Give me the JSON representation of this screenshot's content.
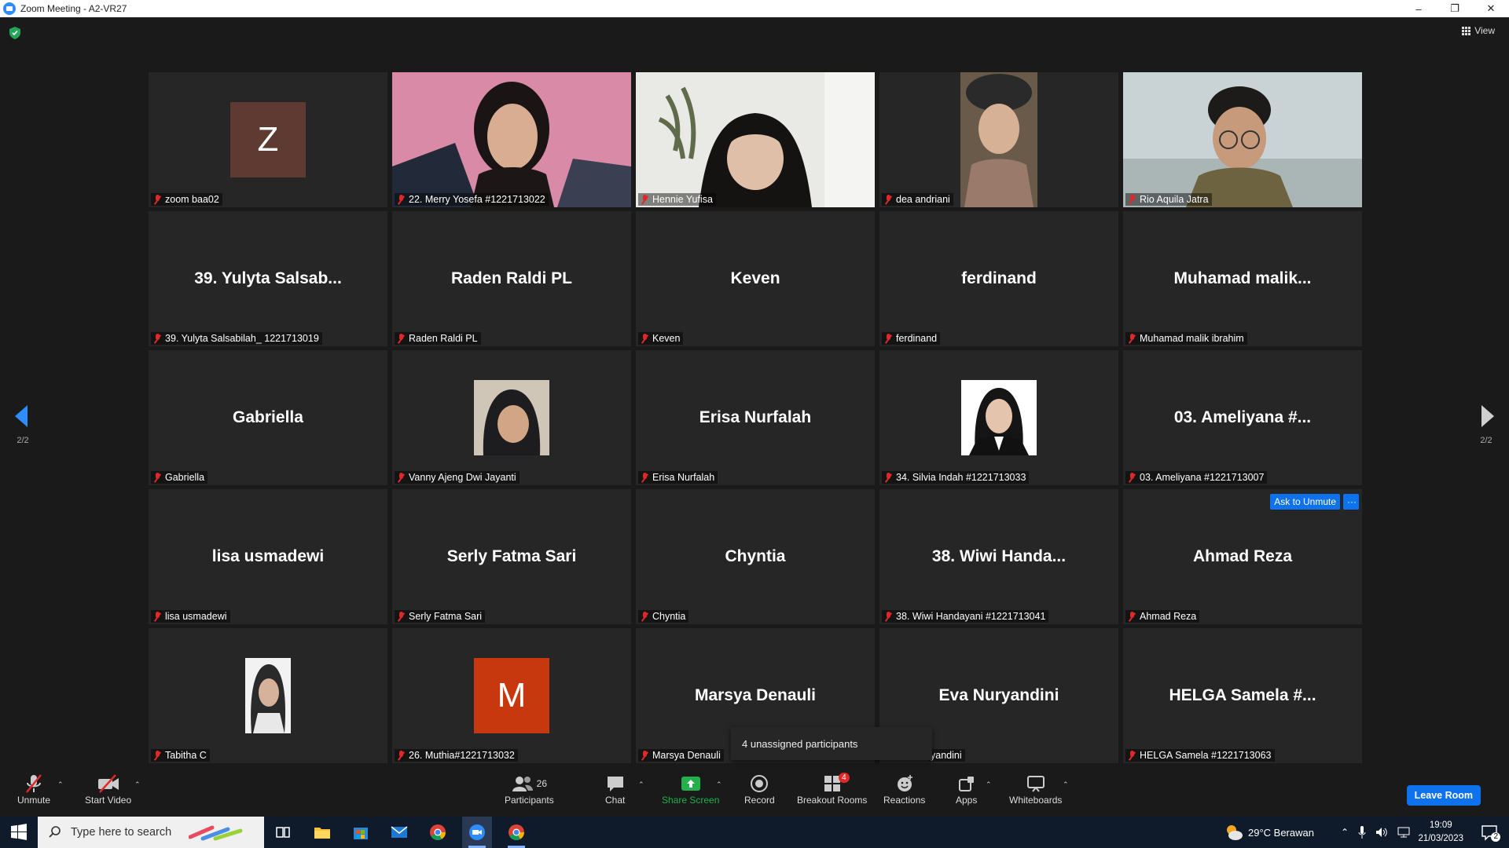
{
  "window": {
    "title": "Zoom Meeting - A2-VR27",
    "minimize": "–",
    "restore": "❐",
    "close": "✕"
  },
  "view": {
    "label": "View"
  },
  "pager": {
    "left": "2/2",
    "right": "2/2"
  },
  "tiles": [
    {
      "label": "zoom baa02",
      "avatar": "Z",
      "avatar_color": "#5e3a33"
    },
    {
      "label": "22. Merry Yosefa #1221713022"
    },
    {
      "label": "Hennie Yufisa"
    },
    {
      "label": "dea andriani"
    },
    {
      "label": "Rio Aquila Jatra"
    },
    {
      "label": "39. Yulyta Salsabilah_ 1221713019",
      "big": "39. Yulyta Salsab..."
    },
    {
      "label": "Raden Raldi PL",
      "big": "Raden Raldi PL"
    },
    {
      "label": "Keven",
      "big": "Keven"
    },
    {
      "label": "ferdinand",
      "big": "ferdinand"
    },
    {
      "label": "Muhamad malik ibrahim",
      "big": "Muhamad  malik..."
    },
    {
      "label": "Gabriella",
      "big": "Gabriella"
    },
    {
      "label": "Vanny Ajeng Dwi Jayanti"
    },
    {
      "label": "Erisa Nurfalah",
      "big": "Erisa Nurfalah"
    },
    {
      "label": "34. Silvia Indah #1221713033"
    },
    {
      "label": "03. Ameliyana #1221713007",
      "big": "03. Ameliyana #..."
    },
    {
      "label": "lisa usmadewi",
      "big": "lisa usmadewi"
    },
    {
      "label": "Serly Fatma Sari",
      "big": "Serly Fatma Sari"
    },
    {
      "label": "Chyntia",
      "big": "Chyntia"
    },
    {
      "label": "38. Wiwi Handayani #1221713041",
      "big": "38. Wiwi Handa..."
    },
    {
      "label": "Ahmad Reza",
      "big": "Ahmad Reza",
      "ask_unmute": "Ask to Unmute",
      "more": "···"
    },
    {
      "label": "Tabitha C"
    },
    {
      "label": "26. Muthia#1221713032",
      "avatar": "M",
      "avatar_color": "#c8380f"
    },
    {
      "label": "Marsya Denauli",
      "big": "Marsya Denauli"
    },
    {
      "label": "yandini",
      "big": "Eva Nuryandini"
    },
    {
      "label": "HELGA Samela #1221713063",
      "big": "HELGA Samela #..."
    }
  ],
  "tooltip": "4 unassigned participants",
  "toolbar": {
    "unmute": "Unmute",
    "start_video": "Start Video",
    "participants": "Participants",
    "participants_count": "26",
    "chat": "Chat",
    "share_screen": "Share Screen",
    "record": "Record",
    "breakout_rooms": "Breakout Rooms",
    "breakout_badge": "4",
    "reactions": "Reactions",
    "apps": "Apps",
    "whiteboards": "Whiteboards",
    "leave": "Leave Room"
  },
  "taskbar": {
    "search_placeholder": "Type here to search",
    "weather": "29°C  Berawan",
    "time": "19:09",
    "date": "21/03/2023",
    "notifications": "2"
  },
  "colors": {
    "accent": "#0e72ed",
    "muted_red": "#e02828",
    "share_green": "#22b14c"
  }
}
